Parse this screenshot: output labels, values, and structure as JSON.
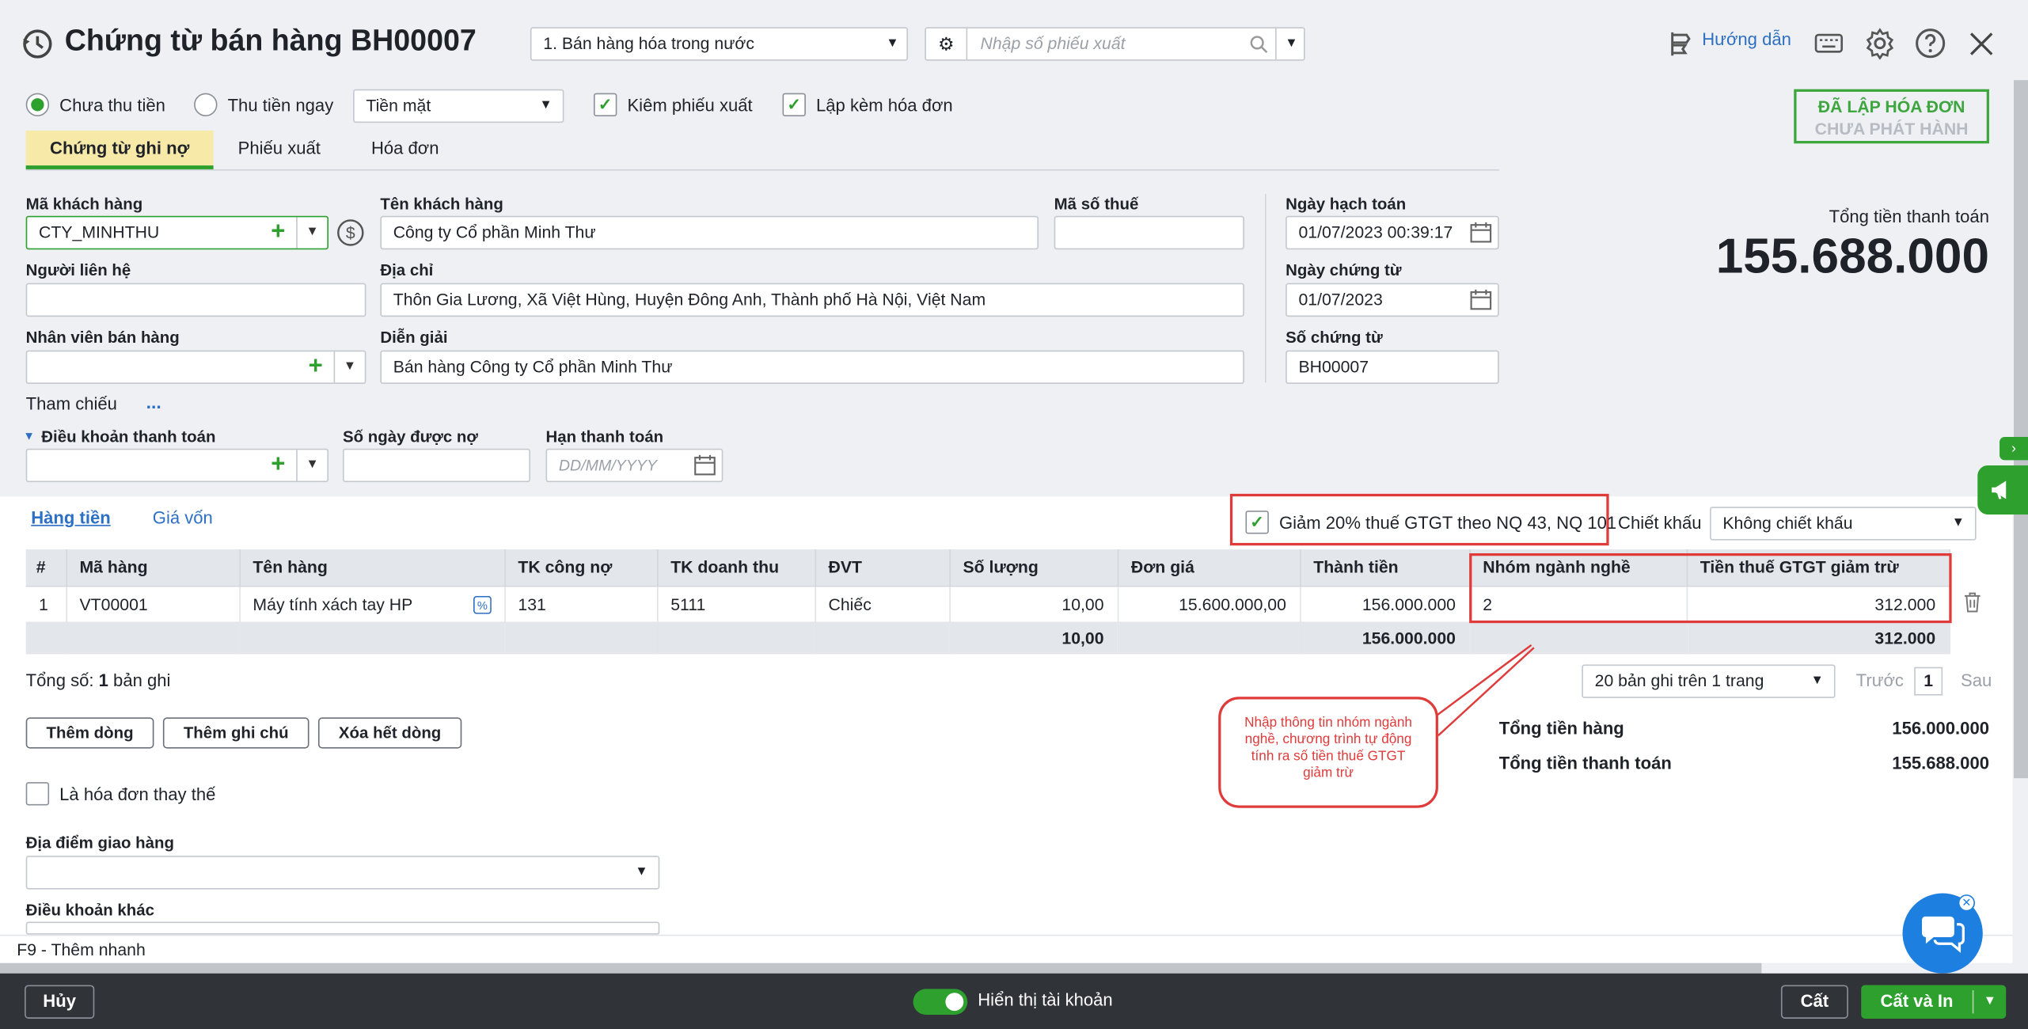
{
  "header": {
    "title": "Chứng từ bán hàng BH00007",
    "voucher_type": "1. Bán hàng hóa trong nước",
    "export_placeholder": "Nhập số phiếu xuất",
    "guide": "Hướng dẫn"
  },
  "options": {
    "unpaid": "Chưa thu tiền",
    "paid_now": "Thu tiền ngay",
    "pay_method": "Tiền mặt",
    "with_export": "Kiêm phiếu xuất",
    "with_invoice": "Lập kèm hóa đơn"
  },
  "stamp": {
    "line1": "ĐÃ LẬP HÓA ĐƠN",
    "line2": "CHƯA PHÁT HÀNH"
  },
  "tabs": [
    "Chứng từ ghi nợ",
    "Phiếu xuất",
    "Hóa đơn"
  ],
  "form": {
    "customer_code_label": "Mã khách hàng",
    "customer_code": "CTY_MINHTHU",
    "customer_name_label": "Tên khách hàng",
    "customer_name": "Công ty Cổ phần Minh Thư",
    "tax_code_label": "Mã số thuế",
    "tax_code": "",
    "contact_label": "Người liên hệ",
    "address_label": "Địa chỉ",
    "address": "Thôn Gia Lương, Xã Việt Hùng, Huyện Đông Anh, Thành phố Hà Nội, Việt Nam",
    "staff_label": "Nhân viên bán hàng",
    "desc_label": "Diễn giải",
    "desc": "Bán hàng Công ty Cổ phần Minh Thư",
    "ref_label": "Tham chiếu",
    "ref_more": "...",
    "terms_label": "Điều khoản thanh toán",
    "debt_days_label": "Số ngày được nợ",
    "due_label": "Hạn thanh toán",
    "due_placeholder": "DD/MM/YYYY",
    "post_date_label": "Ngày hạch toán",
    "post_date": "01/07/2023 00:39:17",
    "voucher_date_label": "Ngày chứng từ",
    "voucher_date": "01/07/2023",
    "voucher_no_label": "Số chứng từ",
    "voucher_no": "BH00007"
  },
  "total_box": {
    "label": "Tổng tiền thanh toán",
    "value": "155.688.000"
  },
  "detail_tabs": [
    "Hàng tiền",
    "Giá vốn"
  ],
  "vat_reduce": "Giảm 20% thuế GTGT theo NQ 43, NQ 101",
  "discount": {
    "label": "Chiết khấu",
    "value": "Không chiết khấu"
  },
  "table": {
    "headers": [
      "#",
      "Mã hàng",
      "Tên hàng",
      "TK công nợ",
      "TK doanh thu",
      "ĐVT",
      "Số lượng",
      "Đơn giá",
      "Thành tiền",
      "Nhóm ngành nghề",
      "Tiền thuế GTGT giảm trừ"
    ],
    "row": [
      "1",
      "VT00001",
      "Máy tính xách tay HP",
      "131",
      "5111",
      "Chiếc",
      "10,00",
      "15.600.000,00",
      "156.000.000",
      "2",
      "312.000"
    ],
    "sum": {
      "qty": "10,00",
      "amount": "156.000.000",
      "vat": "312.000"
    }
  },
  "footer_grid": {
    "count_prefix": "Tổng số: ",
    "count": "1",
    "count_suffix": " bản ghi",
    "page_size": "20 bản ghi trên 1 trang",
    "prev": "Trước",
    "page": "1",
    "next": "Sau"
  },
  "buttons": {
    "add_row": "Thêm dòng",
    "add_note": "Thêm ghi chú",
    "clear_rows": "Xóa hết dòng"
  },
  "callout": "Nhập thông tin nhóm ngành nghề, chương trình tự động tính ra số tiền thuế GTGT giảm trừ",
  "totals": {
    "goods_label": "Tổng tiền hàng",
    "goods": "156.000.000",
    "pay_label": "Tổng tiền thanh toán",
    "pay": "155.688.000"
  },
  "replace_invoice": "Là hóa đơn thay thế",
  "delivery_label": "Địa điểm giao hàng",
  "other_terms_label": "Điều khoản khác",
  "hint": "F9 - Thêm nhanh",
  "bottom": {
    "cancel": "Hủy",
    "show_account": "Hiển thị tài khoản",
    "save": "Cất",
    "save_print": "Cất và In"
  }
}
